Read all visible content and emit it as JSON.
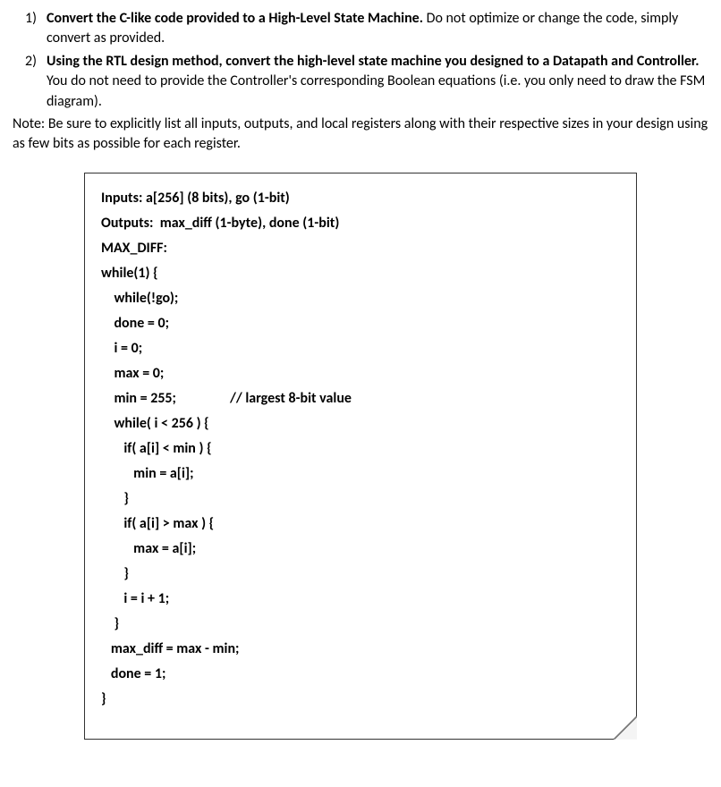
{
  "questions": [
    {
      "number": "1)",
      "bold_text": "Convert the C-like code provided to a High-Level State Machine.",
      "rest_text": " Do not optimize or change the code, simply convert as provided."
    },
    {
      "number": "2)",
      "bold_text": "Using the RTL design method, convert the high-level state machine you designed to a Datapath and Controller.",
      "rest_text": " You do not need to provide the Controller's corresponding Boolean equations (i.e. you only need to draw the FSM diagram)."
    }
  ],
  "note": "Note: Be sure to explicitly list all inputs, outputs, and local registers along with their respective sizes in your design using as few bits as possible for each register.",
  "code": {
    "l1": "Inputs: a[256] (8 bits), go (1-bit)",
    "l2": "Outputs:  max_diff (1-byte), done (1-bit)",
    "l3": "MAX_DIFF:",
    "l4": "while(1) {",
    "l5": "    while(!go);",
    "l6": "    done = 0;",
    "l7": "    i = 0;",
    "l8": "    max = 0;",
    "l9": "    min = 255;",
    "l9_comment": "// largest 8-bit value",
    "l10": "    while( i < 256 ) {",
    "l11": "       if( a[i] < min ) {",
    "l12": "          min = a[i];",
    "l13": "       }",
    "l14": "       if( a[i] > max ) {",
    "l15": "          max = a[i];",
    "l16": "       }",
    "l17": "       i = i + 1;",
    "l18": "    }",
    "l19": "   max_diff = max - min;",
    "l20": "   done = 1;",
    "l21": "}"
  }
}
